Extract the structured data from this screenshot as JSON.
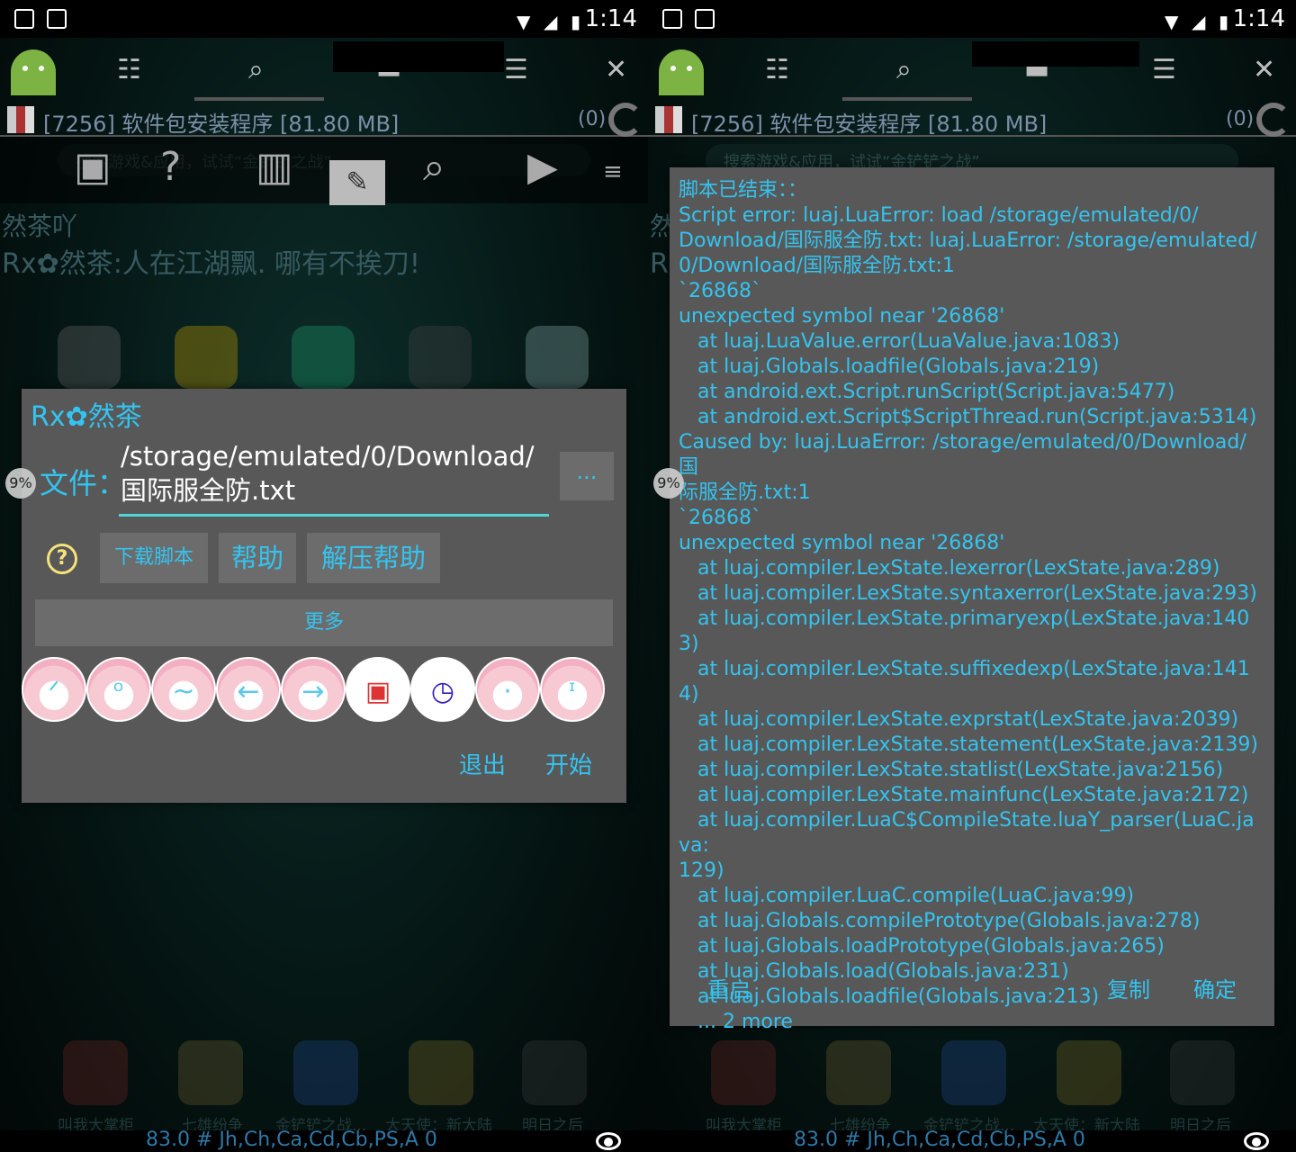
{
  "status": {
    "time": "1:14"
  },
  "process": {
    "title": "[7256] 软件包安装程序 [81.80 MB]",
    "count": "(0)"
  },
  "search": {
    "placeholder": "搜索游戏&应用，试试“金铲铲之战”"
  },
  "marquee": {
    "line1": "然茶吖",
    "line2": "Rx✿然茶:人在江湖飘. 哪有不挨刀!"
  },
  "overlay": {
    "percent": "9%"
  },
  "left_dialog": {
    "title": "Rx✿然茶",
    "file_label": "文件：",
    "file_value": "/storage/emulated/0/Download/\n国际服全防.txt",
    "browse_label": "...",
    "help_icon": "?",
    "download_script": "下载脚本",
    "help": "帮助",
    "unzip_help": "解压帮助",
    "more": "更多",
    "quick_icons": [
      "cry-face-icon",
      "surprised-face-icon",
      "wave-face-icon",
      "left-arrow-face-icon",
      "right-arrow-face-icon",
      "grid-select-icon",
      "history-icon",
      "dot-face-icon",
      "tear-face-icon"
    ],
    "exit": "退出",
    "start": "开始"
  },
  "right_dialog": {
    "message": "脚本已结束：：\nScript error: luaj.LuaError: load /storage/emulated/0/\nDownload/国际服全防.txt: luaj.LuaError: /storage/emulated/\n0/Download/国际服全防.txt:1\n`26868`\nunexpected symbol near '26868'\n   at luaj.LuaValue.error(LuaValue.java:1083)\n   at luaj.Globals.loadfile(Globals.java:219)\n   at android.ext.Script.runScript(Script.java:5477)\n   at android.ext.Script$ScriptThread.run(Script.java:5314)\nCaused by: luaj.LuaError: /storage/emulated/0/Download/国\n际服全防.txt:1\n`26868`\nunexpected symbol near '26868'\n   at luaj.compiler.LexState.lexerror(LexState.java:289)\n   at luaj.compiler.LexState.syntaxerror(LexState.java:293)\n   at luaj.compiler.LexState.primaryexp(LexState.java:1403)\n   at luaj.compiler.LexState.suffixedexp(LexState.java:1414)\n   at luaj.compiler.LexState.exprstat(LexState.java:2039)\n   at luaj.compiler.LexState.statement(LexState.java:2139)\n   at luaj.compiler.LexState.statlist(LexState.java:2156)\n   at luaj.compiler.LexState.mainfunc(LexState.java:2172)\n   at luaj.compiler.LuaC$CompileState.luaY_parser(LuaC.java:\n129)\n   at luaj.compiler.LuaC.compile(LuaC.java:99)\n   at luaj.Globals.compilePrototype(Globals.java:278)\n   at luaj.Globals.loadPrototype(Globals.java:265)\n   at luaj.Globals.load(Globals.java:231)\n   at luaj.Globals.loadfile(Globals.java:213)\n   ... 2 more",
    "restart": "重启",
    "copy": "复制",
    "ok": "确定"
  },
  "bottom_apps": [
    "叫我大掌柜",
    "七雄纷争",
    "金铲铲之战...",
    "大天使：新大陆",
    "明日之后"
  ],
  "bottom_bar": {
    "text": "83.0 # Jh,Ch,Ca,Cd,Cb,PS,A 0"
  },
  "colors": {
    "accent": "#33c4f0",
    "dialog_bg": "#585858",
    "button_bg": "#6c6c6c",
    "underline": "#4fd6d6"
  }
}
